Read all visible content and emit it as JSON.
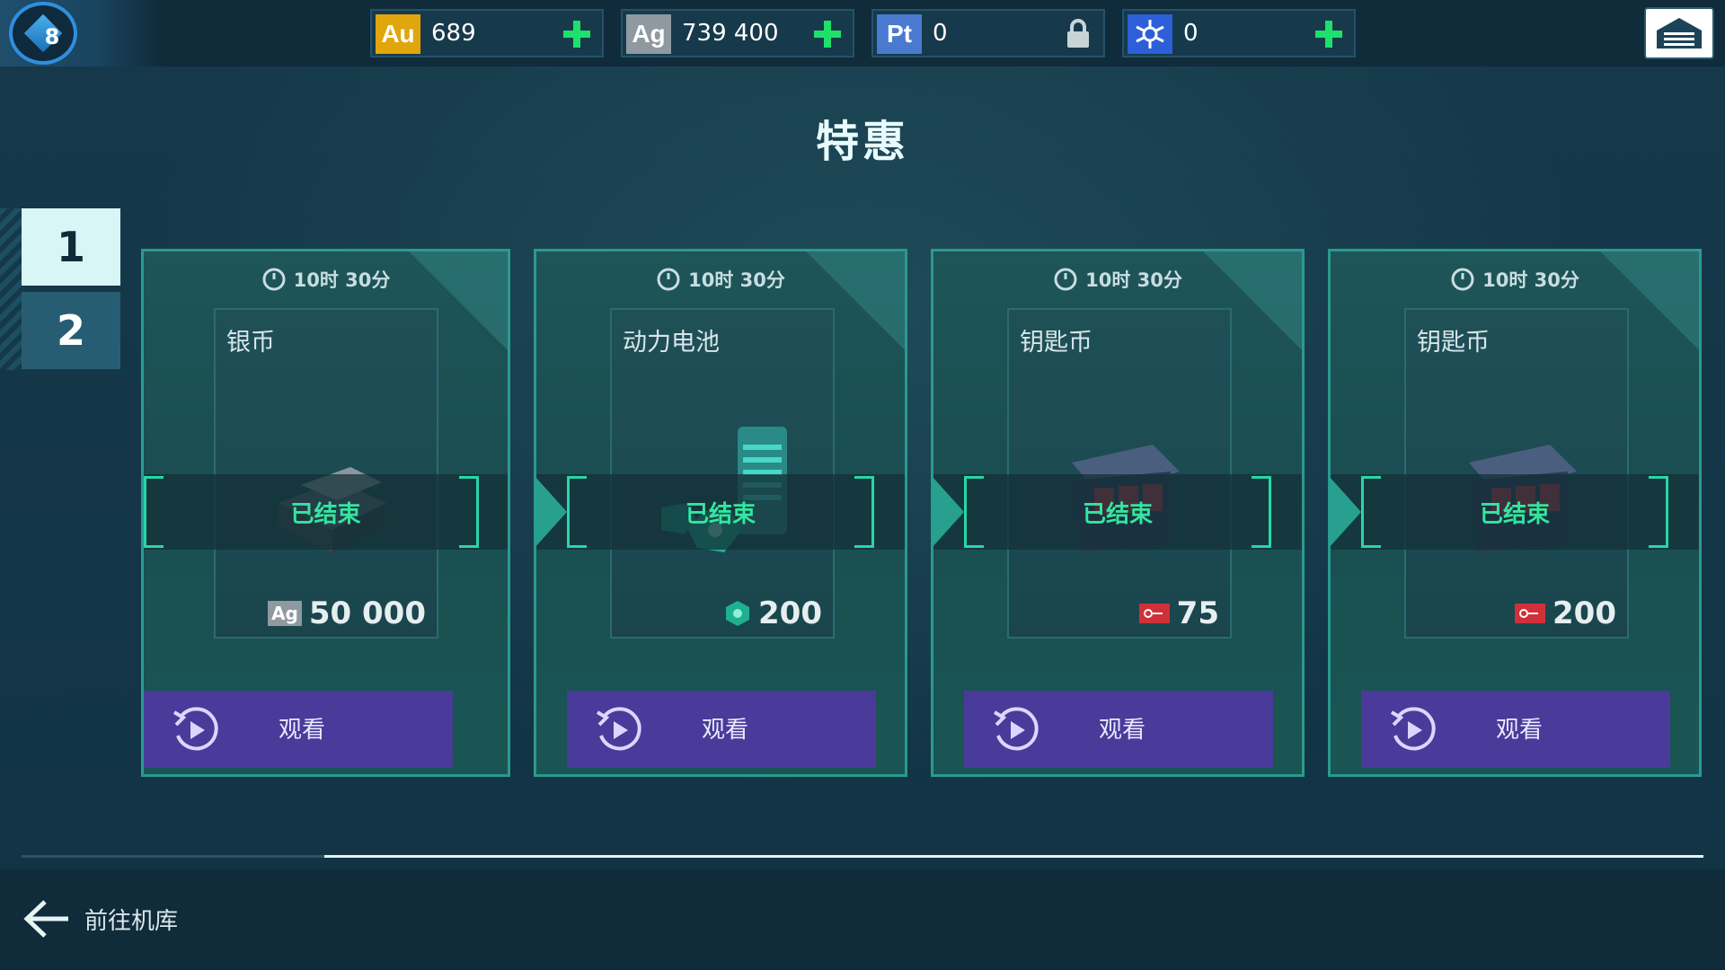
{
  "player": {
    "level": "8"
  },
  "currencies": [
    {
      "badge": "Au",
      "value": "689",
      "badge_color": "#e0a60c",
      "action": "plus"
    },
    {
      "badge": "Ag",
      "value": "739 400",
      "badge_color": "#8e9aa0",
      "action": "plus"
    },
    {
      "badge": "Pt",
      "value": "0",
      "badge_color": "#4a7ad0",
      "action": "lock"
    },
    {
      "badge": "",
      "value": "0",
      "badge_color": "#2d5fd8",
      "action": "plus",
      "badge_icon": "network-icon"
    }
  ],
  "title": "特惠",
  "page_tabs": [
    {
      "label": "1",
      "active": true
    },
    {
      "label": "2",
      "active": false
    }
  ],
  "offers": [
    {
      "timer": "10时 30分",
      "name": "银币",
      "status": "已结束",
      "price": "50 000",
      "price_icon": "silver-coin-icon",
      "button_label": "观看"
    },
    {
      "timer": "10时 30分",
      "name": "动力电池",
      "status": "已结束",
      "price": "200",
      "price_icon": "power-cell-icon",
      "button_label": "观看"
    },
    {
      "timer": "10时 30分",
      "name": "钥匙币",
      "status": "已结束",
      "price": "75",
      "price_icon": "key-icon",
      "button_label": "观看"
    },
    {
      "timer": "10时 30分",
      "name": "钥匙币",
      "status": "已结束",
      "price": "200",
      "price_icon": "key-icon",
      "button_label": "观看"
    }
  ],
  "progress": {
    "fraction": 0.18
  },
  "footer": {
    "back_label": "前往机库"
  },
  "colors": {
    "accent": "#28d6a8",
    "watch_button": "#4a3a9a",
    "plus": "#1fe06a"
  }
}
